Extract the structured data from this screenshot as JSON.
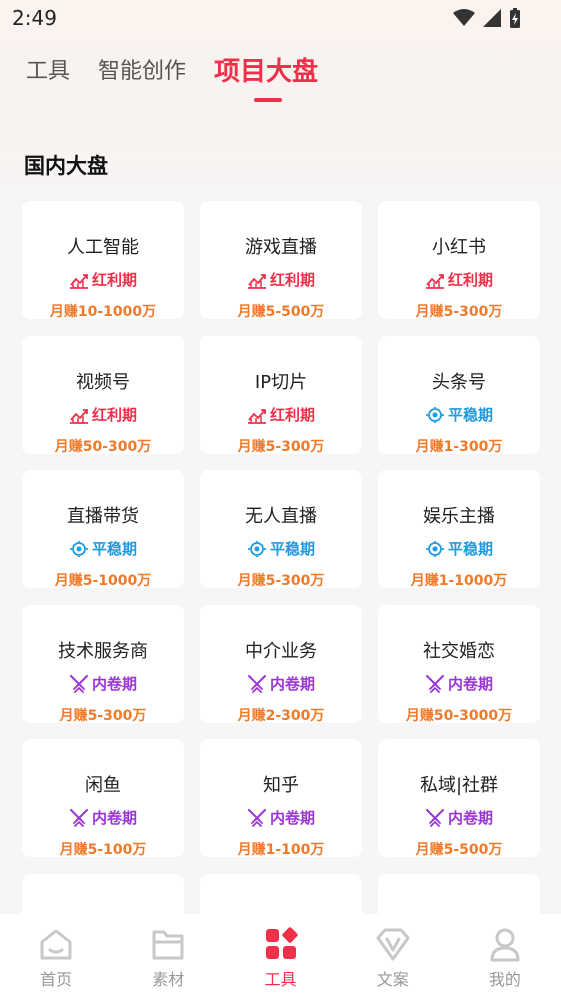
{
  "status": {
    "time": "2:49"
  },
  "tabs": [
    {
      "label": "工具",
      "active": false
    },
    {
      "label": "智能创作",
      "active": false
    },
    {
      "label": "项目大盘",
      "active": true
    }
  ],
  "section": {
    "title": "国内大盘"
  },
  "cards": [
    {
      "name": "人工智能",
      "tag": "红利期",
      "tag_type": "red",
      "earn": "月赚10-1000万"
    },
    {
      "name": "游戏直播",
      "tag": "红利期",
      "tag_type": "red",
      "earn": "月赚5-500万"
    },
    {
      "name": "小红书",
      "tag": "红利期",
      "tag_type": "red",
      "earn": "月赚5-300万"
    },
    {
      "name": "视频号",
      "tag": "红利期",
      "tag_type": "red",
      "earn": "月赚50-300万"
    },
    {
      "name": "IP切片",
      "tag": "红利期",
      "tag_type": "red",
      "earn": "月赚5-300万"
    },
    {
      "name": "头条号",
      "tag": "平稳期",
      "tag_type": "blue",
      "earn": "月赚1-300万"
    },
    {
      "name": "直播带货",
      "tag": "平稳期",
      "tag_type": "blue",
      "earn": "月赚5-1000万"
    },
    {
      "name": "无人直播",
      "tag": "平稳期",
      "tag_type": "blue",
      "earn": "月赚5-300万"
    },
    {
      "name": "娱乐主播",
      "tag": "平稳期",
      "tag_type": "blue",
      "earn": "月赚1-1000万"
    },
    {
      "name": "技术服务商",
      "tag": "内卷期",
      "tag_type": "purple",
      "earn": "月赚5-300万"
    },
    {
      "name": "中介业务",
      "tag": "内卷期",
      "tag_type": "purple",
      "earn": "月赚2-300万"
    },
    {
      "name": "社交婚恋",
      "tag": "内卷期",
      "tag_type": "purple",
      "earn": "月赚50-3000万"
    },
    {
      "name": "闲鱼",
      "tag": "内卷期",
      "tag_type": "purple",
      "earn": "月赚5-100万"
    },
    {
      "name": "知乎",
      "tag": "内卷期",
      "tag_type": "purple",
      "earn": "月赚1-100万"
    },
    {
      "name": "私域|社群",
      "tag": "内卷期",
      "tag_type": "purple",
      "earn": "月赚5-500万"
    }
  ],
  "bottom_nav": [
    {
      "label": "首页",
      "icon": "home-icon",
      "active": false
    },
    {
      "label": "素材",
      "icon": "folder-icon",
      "active": false
    },
    {
      "label": "工具",
      "icon": "tools-grid-icon",
      "active": true
    },
    {
      "label": "文案",
      "icon": "diamond-v-icon",
      "active": false
    },
    {
      "label": "我的",
      "icon": "user-icon",
      "active": false
    }
  ],
  "colors": {
    "accent": "#f0304a",
    "earn": "#f07a2a",
    "stable": "#1e9be0",
    "involution": "#9b35d6"
  }
}
